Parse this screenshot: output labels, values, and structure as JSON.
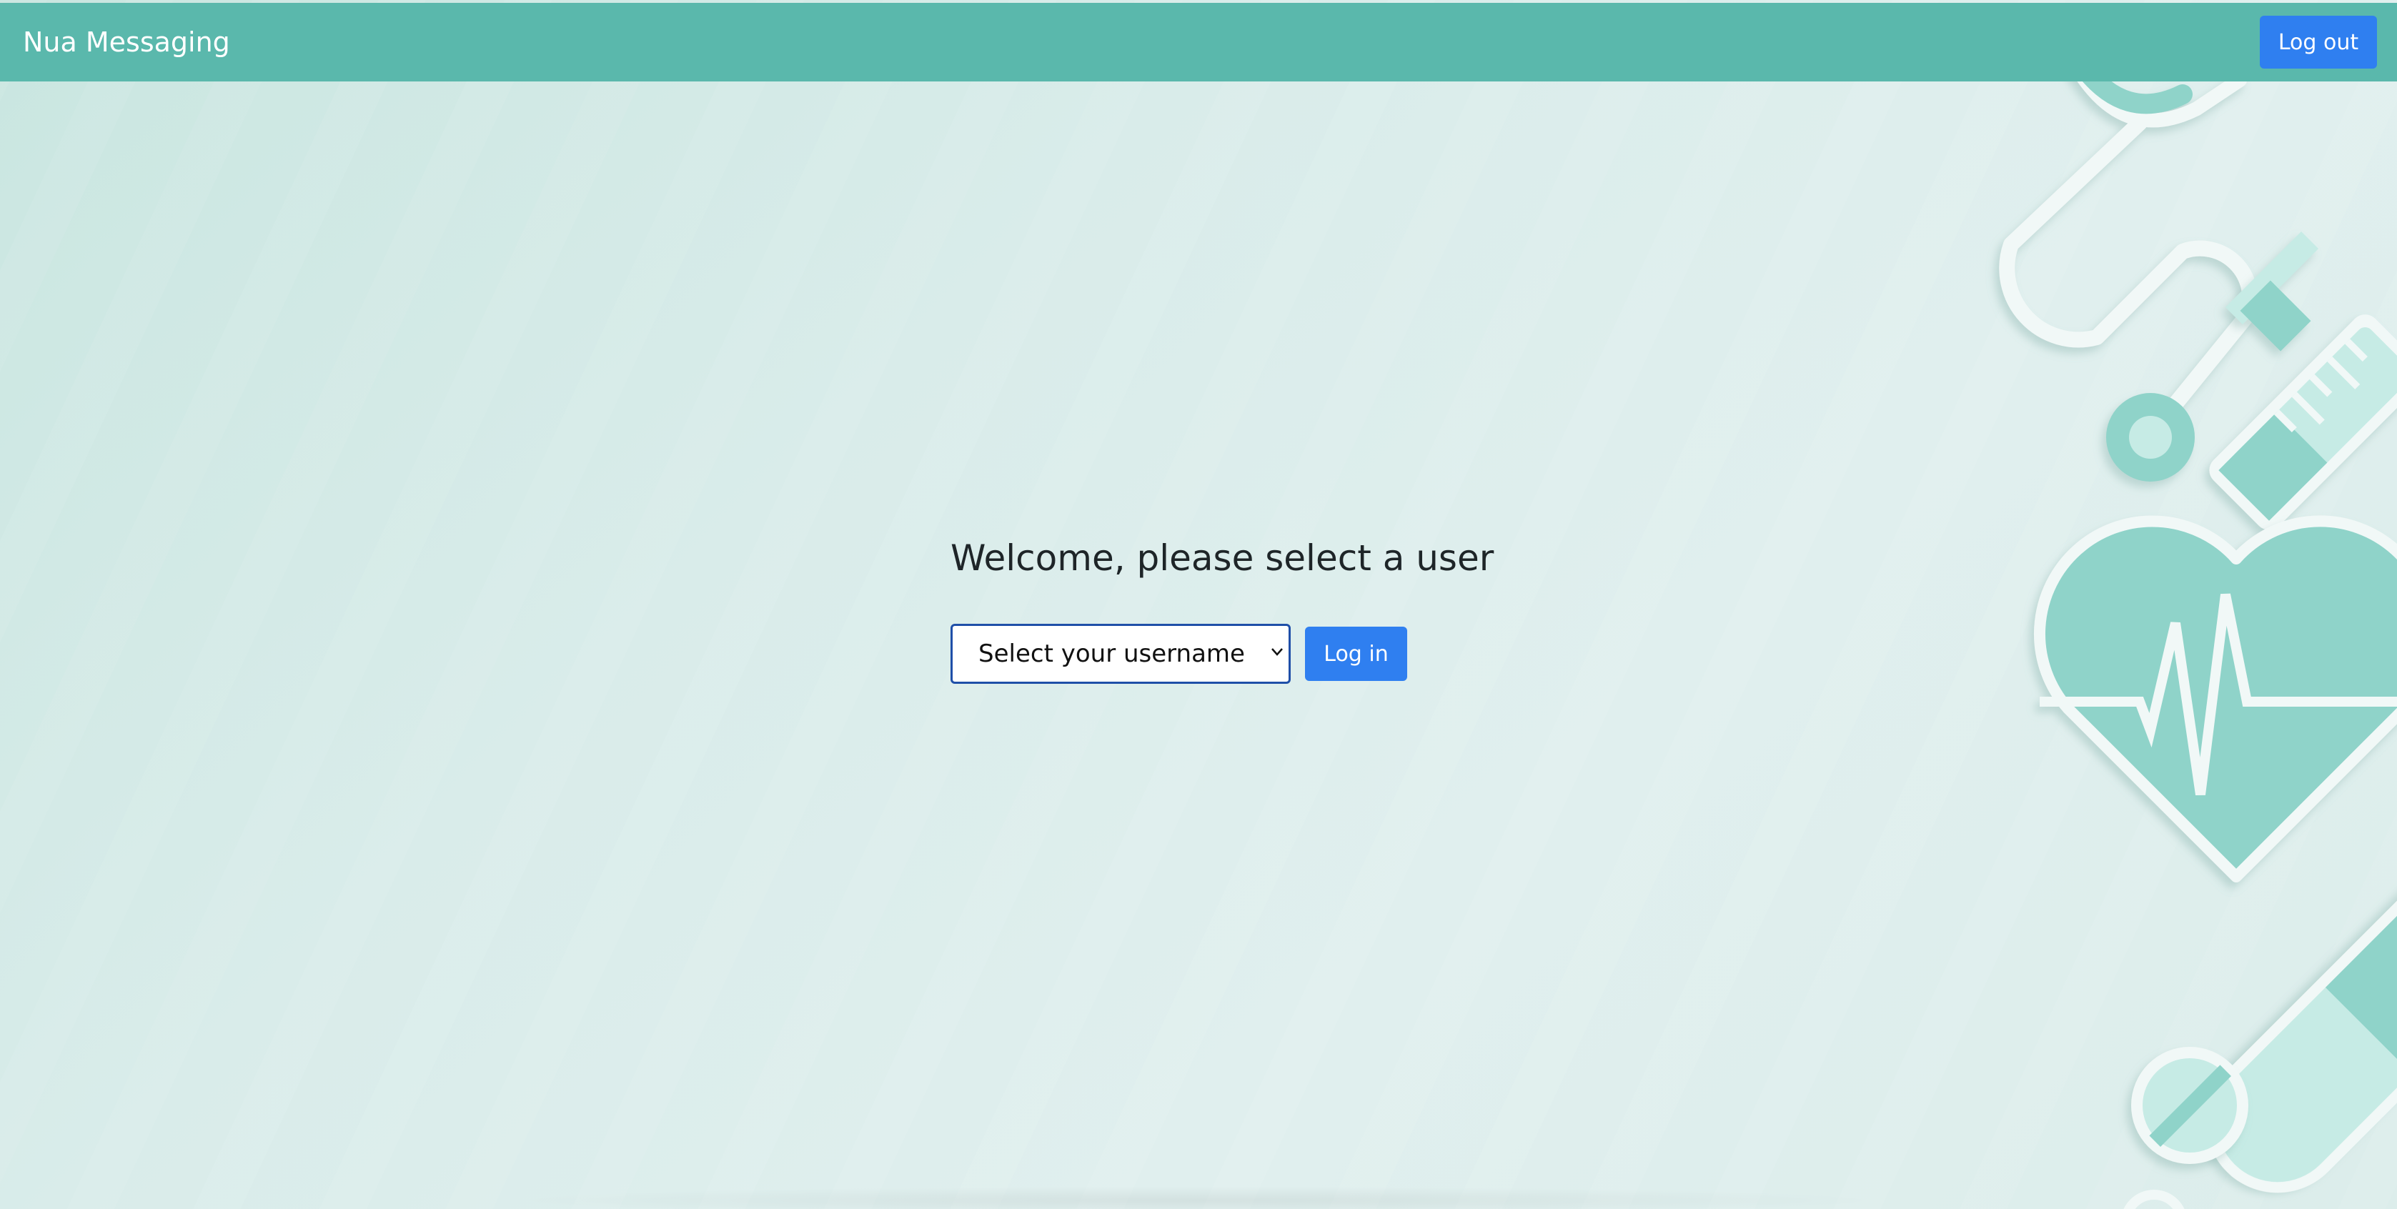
{
  "app": {
    "brand": "Nua Messaging"
  },
  "navbar": {
    "logout_label": "Log out"
  },
  "main": {
    "title": "Welcome, please select a user",
    "select": {
      "selected": "Select your username"
    },
    "login_label": "Log in"
  },
  "colors": {
    "navbar": "#5ab8ac",
    "primary_button": "#2f7ff0",
    "background": "#d9ecea",
    "illustration": "#8fd3c9"
  },
  "icons": {
    "select_chevron": "chevron-down-icon",
    "decor": [
      "stethoscope-icon",
      "syringe-icon",
      "heartbeat-heart-icon",
      "capsule-icon",
      "pill-icon"
    ]
  }
}
